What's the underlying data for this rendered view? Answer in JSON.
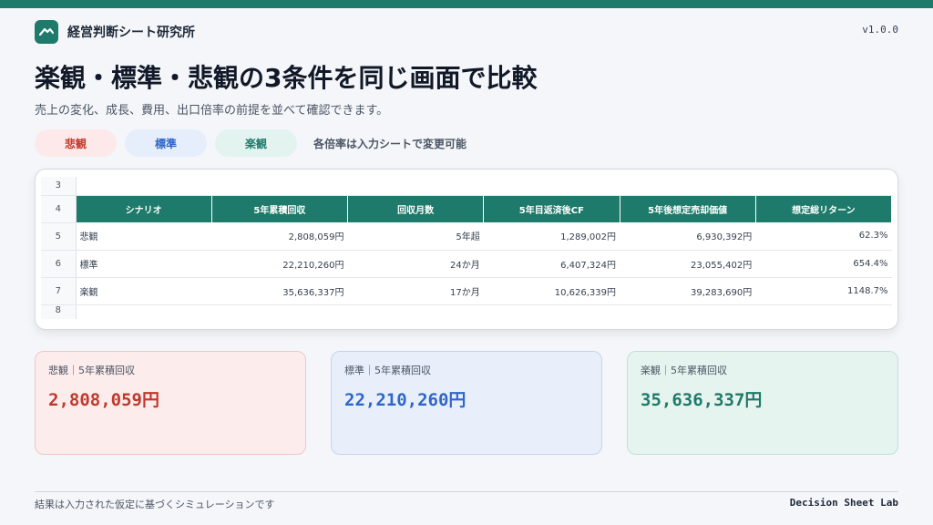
{
  "header": {
    "brand_name": "経営判断シート研究所",
    "version": "v1.0.0"
  },
  "main": {
    "title": "楽観・標準・悲観の3条件を同じ画面で比較",
    "subtitle": "売上の変化、成長、費用、出口倍率の前提を並べて確認できます。"
  },
  "pills": {
    "pessimistic": "悲観",
    "standard": "標準",
    "optimistic": "楽観",
    "note": "各倍率は入力シートで変更可能"
  },
  "sheet": {
    "row_numbers": [
      "3",
      "4",
      "5",
      "6",
      "7",
      "8"
    ],
    "headers": [
      "シナリオ",
      "5年累積回収",
      "回収月数",
      "5年目返済後CF",
      "5年後想定売却価値",
      "想定総リターン"
    ],
    "rows": [
      [
        "悲観",
        "2,808,059円",
        "5年超",
        "1,289,002円",
        "6,930,392円",
        "62.3%"
      ],
      [
        "標準",
        "22,210,260円",
        "24か月",
        "6,407,324円",
        "23,055,402円",
        "654.4%"
      ],
      [
        "楽観",
        "35,636,337円",
        "17か月",
        "10,626,339円",
        "39,283,690円",
        "1148.7%"
      ]
    ]
  },
  "cards": [
    {
      "label": "悲観｜5年累積回収",
      "value": "2,808,059円"
    },
    {
      "label": "標準｜5年累積回収",
      "value": "22,210,260円"
    },
    {
      "label": "楽観｜5年累積回収",
      "value": "35,636,337円"
    }
  ],
  "footer": {
    "note": "結果は入力された仮定に基づくシミュレーションです",
    "brand": "Decision Sheet Lab"
  },
  "colors": {
    "accent": "#1e7a6a",
    "pessimistic": "#c0392b",
    "standard": "#2f66c9",
    "optimistic": "#1e7a6a"
  }
}
